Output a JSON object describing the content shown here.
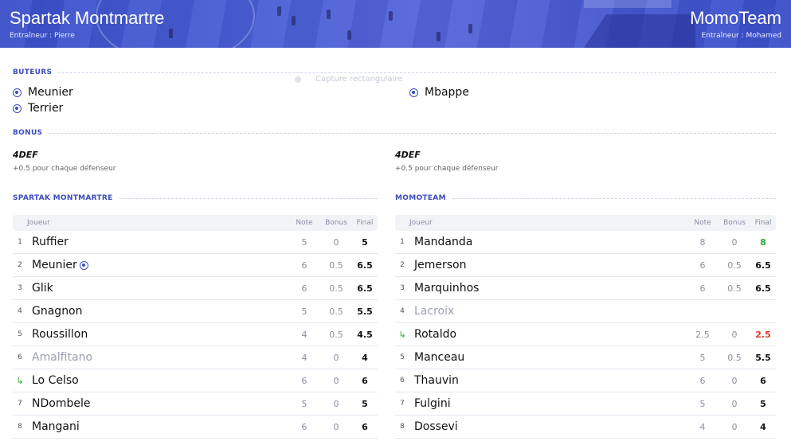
{
  "header": {
    "home_name": "Spartak Montmartre",
    "home_coach": "Entraîneur : Pierre",
    "away_name": "MomoTeam",
    "away_coach": "Entraîneur : Mohamed"
  },
  "sections": {
    "scorers": "BUTEURS",
    "bonus": "BONUS",
    "home_table": "SPARTAK MONTMARTRE",
    "away_table": "MOMOTEAM"
  },
  "ghost_label": "Capture rectangulaire",
  "scorers": {
    "home": [
      "Meunier",
      "Terrier"
    ],
    "away": [
      "Mbappe"
    ]
  },
  "bonus": {
    "home": {
      "name": "4DEF",
      "desc": "+0.5 pour chaque défenseur"
    },
    "away": {
      "name": "4DEF",
      "desc": "+0.5 pour chaque défenseur"
    }
  },
  "columns": {
    "player": "Joueur",
    "note": "Note",
    "bonus": "Bonus",
    "final": "Final"
  },
  "home_players": [
    {
      "num": "1",
      "name": "Ruffier",
      "note": "5",
      "bonus": "0",
      "final": "5"
    },
    {
      "num": "2",
      "name": "Meunier",
      "note": "6",
      "bonus": "0.5",
      "final": "6.5",
      "scored": true
    },
    {
      "num": "3",
      "name": "Glik",
      "note": "6",
      "bonus": "0.5",
      "final": "6.5"
    },
    {
      "num": "4",
      "name": "Gnagnon",
      "note": "5",
      "bonus": "0.5",
      "final": "5.5"
    },
    {
      "num": "5",
      "name": "Roussillon",
      "note": "4",
      "bonus": "0.5",
      "final": "4.5"
    },
    {
      "num": "6",
      "name": "Amalfitano",
      "note": "4",
      "bonus": "0",
      "final": "4",
      "dim": true
    },
    {
      "num": "↳",
      "name": "Lo Celso",
      "note": "6",
      "bonus": "0",
      "final": "6",
      "sub": true
    },
    {
      "num": "7",
      "name": "NDombele",
      "note": "5",
      "bonus": "0",
      "final": "5"
    },
    {
      "num": "8",
      "name": "Mangani",
      "note": "6",
      "bonus": "0",
      "final": "6"
    }
  ],
  "away_players": [
    {
      "num": "1",
      "name": "Mandanda",
      "note": "8",
      "bonus": "0",
      "final": "8",
      "final_color": "#2eaa3b"
    },
    {
      "num": "2",
      "name": "Jemerson",
      "note": "6",
      "bonus": "0.5",
      "final": "6.5"
    },
    {
      "num": "3",
      "name": "Marquinhos",
      "note": "6",
      "bonus": "0.5",
      "final": "6.5"
    },
    {
      "num": "4",
      "name": "Lacroix",
      "note": "",
      "bonus": "",
      "final": "",
      "dim": true
    },
    {
      "num": "↳",
      "name": "Rotaldo",
      "note": "2.5",
      "bonus": "0",
      "final": "2.5",
      "sub": true,
      "final_color": "#e0392b"
    },
    {
      "num": "5",
      "name": "Manceau",
      "note": "5",
      "bonus": "0.5",
      "final": "5.5"
    },
    {
      "num": "6",
      "name": "Thauvin",
      "note": "6",
      "bonus": "0",
      "final": "6"
    },
    {
      "num": "7",
      "name": "Fulgini",
      "note": "5",
      "bonus": "0",
      "final": "5"
    },
    {
      "num": "8",
      "name": "Dossevi",
      "note": "4",
      "bonus": "0",
      "final": "4"
    }
  ],
  "colors": {
    "accent": "#3b4cc0",
    "positive": "#2eaa3b",
    "negative": "#e0392b"
  }
}
